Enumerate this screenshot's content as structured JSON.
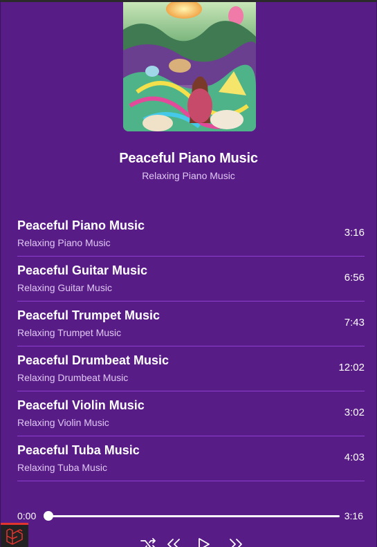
{
  "now_playing": {
    "title": "Peaceful Piano Music",
    "artist": "Relaxing Piano Music"
  },
  "tracks": [
    {
      "title": "Peaceful Piano Music",
      "artist": "Relaxing Piano Music",
      "duration": "3:16"
    },
    {
      "title": "Peaceful Guitar Music",
      "artist": "Relaxing Guitar Music",
      "duration": "6:56"
    },
    {
      "title": "Peaceful Trumpet Music",
      "artist": "Relaxing Trumpet Music",
      "duration": "7:43"
    },
    {
      "title": "Peaceful Drumbeat Music",
      "artist": "Relaxing Drumbeat Music",
      "duration": "12:02"
    },
    {
      "title": "Peaceful Violin Music",
      "artist": "Relaxing Violin Music",
      "duration": "3:02"
    },
    {
      "title": "Peaceful Tuba Music",
      "artist": "Relaxing Tuba Music",
      "duration": "4:03"
    }
  ],
  "player": {
    "current_time": "0:00",
    "total_time": "3:16",
    "progress": 0
  },
  "icons": {
    "shuffle": "shuffle-icon",
    "previous": "previous-icon",
    "play": "play-icon",
    "next": "next-icon",
    "badge": "laravel-logo-icon"
  },
  "colors": {
    "background": "#581c87",
    "divider": "#8c3fd0",
    "subtext": "#e0c8f5",
    "badge_accent": "#e3342f"
  }
}
